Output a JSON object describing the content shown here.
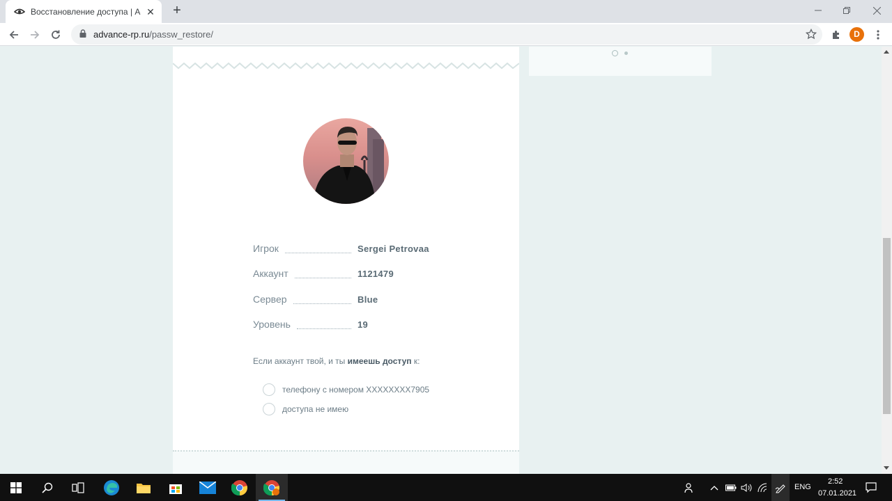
{
  "browser": {
    "tab_title": "Восстановление доступа | Advance",
    "tab_close": "✕",
    "new_tab": "+",
    "url_host": "advance-rp.ru",
    "url_path": "/passw_restore/",
    "profile_initial": "D"
  },
  "profile": {
    "rows": [
      {
        "label": "Игрок",
        "value": "Sergei  Petrovaa"
      },
      {
        "label": "Аккаунт",
        "value": "1121479"
      },
      {
        "label": "Сервер",
        "value": "Blue"
      },
      {
        "label": "Уровень",
        "value": "19"
      }
    ]
  },
  "recovery": {
    "question_prefix": "Если аккаунт твой, и ты ",
    "question_bold": "имеешь доступ",
    "question_suffix": " к:",
    "options": [
      {
        "label": "телефону с номером XXXXXXXX7905"
      },
      {
        "label": "доступа не имею"
      }
    ]
  },
  "taskbar": {
    "language": "ENG",
    "time": "2:52",
    "date": "07.01.2021"
  },
  "colors": {
    "page_bg": "#e8f1f1",
    "card_bg": "#ffffff",
    "accent_orange": "#e8710a"
  }
}
